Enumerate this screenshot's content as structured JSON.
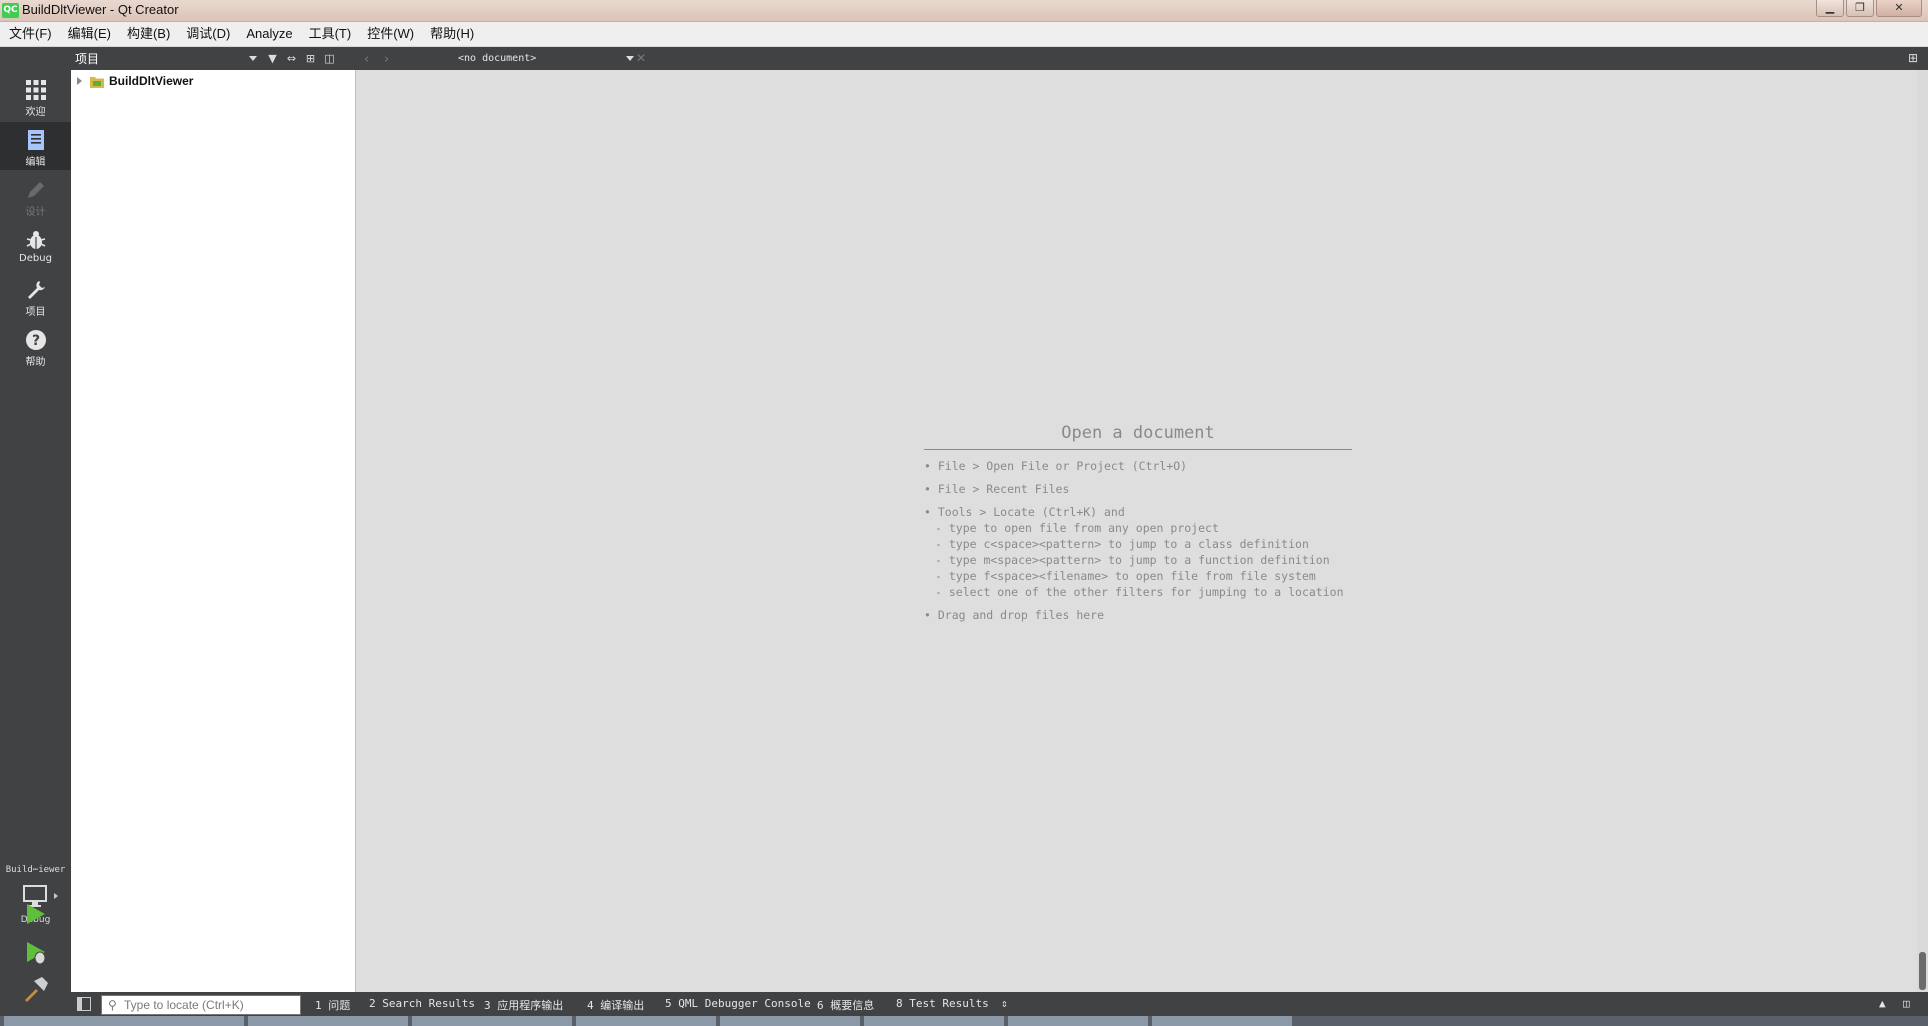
{
  "window": {
    "title": "BuildDltViewer - Qt Creator",
    "logo_text": "QC",
    "controls": [
      "minimize",
      "maximize",
      "close"
    ]
  },
  "menu": [
    "文件(F)",
    "编辑(E)",
    "构建(B)",
    "调试(D)",
    "Analyze",
    "工具(T)",
    "控件(W)",
    "帮助(H)"
  ],
  "modes": [
    {
      "label": "欢迎",
      "icon": "grid-icon",
      "state": "normal"
    },
    {
      "label": "编辑",
      "icon": "edit-document-icon",
      "state": "active"
    },
    {
      "label": "设计",
      "icon": "pencil-icon",
      "state": "disabled"
    },
    {
      "label": "Debug",
      "icon": "bug-icon",
      "state": "normal"
    },
    {
      "label": "项目",
      "icon": "wrench-icon",
      "state": "normal"
    },
    {
      "label": "帮助",
      "icon": "help-icon",
      "state": "normal"
    }
  ],
  "kit": {
    "name": "Build⋯iewer",
    "mode": "Debug"
  },
  "project_pane": {
    "header": "项目",
    "tree": [
      {
        "label": "BuildDltViewer",
        "expanded": false
      }
    ]
  },
  "editor": {
    "document_combo": "<no document>",
    "open_document": {
      "title": "Open a document",
      "items": [
        {
          "text": "• File > Open File or Project (Ctrl+O)",
          "sub": []
        },
        {
          "text": "• File > Recent Files",
          "sub": []
        },
        {
          "text": "• Tools > Locate (Ctrl+K) and",
          "sub": [
            "- type to open file from any open project",
            "- type c<space><pattern> to jump to a class definition",
            "- type m<space><pattern> to jump to a function definition",
            "- type f<space><filename> to open file from file system",
            "- select one of the other filters for jumping to a location"
          ]
        },
        {
          "text": "• Drag and drop files here",
          "sub": []
        }
      ]
    }
  },
  "statusbar": {
    "locate_placeholder": "Type to locate (Ctrl+K)",
    "output_tabs": [
      "1 问题",
      "2 Search Results",
      "3 应用程序输出",
      "4 编译输出",
      "5 QML Debugger Console",
      "6 概要信息",
      "8 Test Results"
    ]
  },
  "colors": {
    "sidebar": "#404244",
    "editor_bg": "#dedede",
    "run_green": "#5fbf3a"
  }
}
